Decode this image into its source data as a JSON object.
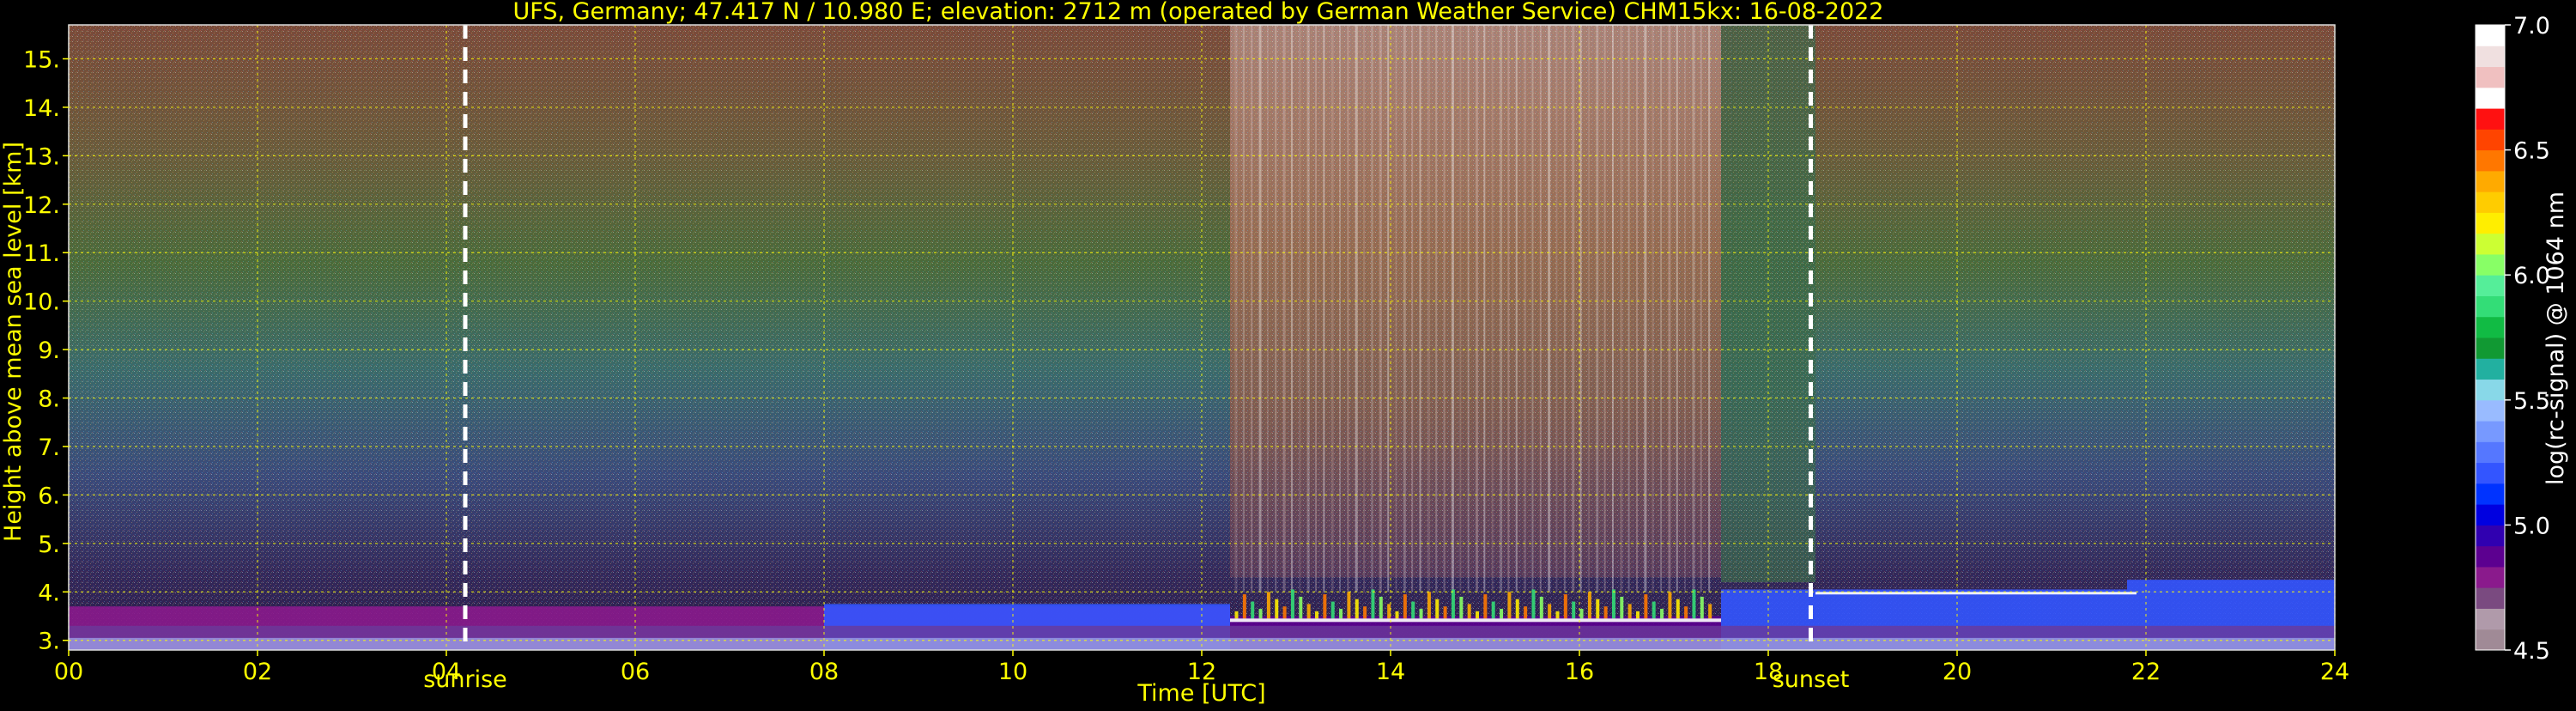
{
  "chart_data": {
    "type": "heatmap",
    "title": "UFS, Germany; 47.417 N / 10.980 E; elevation: 2712 m  (operated by German Weather Service)    CHM15kx: 16-08-2022",
    "xlabel": "Time [UTC]",
    "ylabel": "Height above mean sea level [km]",
    "xlim": [
      0,
      24
    ],
    "ylim": [
      2.8,
      15.7
    ],
    "x_ticks": [
      0,
      2,
      4,
      6,
      8,
      10,
      12,
      14,
      16,
      18,
      20,
      22,
      24
    ],
    "x_tick_labels": [
      "00",
      "02",
      "04",
      "06",
      "08",
      "10",
      "12",
      "14",
      "16",
      "18",
      "20",
      "22",
      "24"
    ],
    "y_ticks": [
      3,
      4,
      5,
      6,
      7,
      8,
      9,
      10,
      11,
      12,
      13,
      14,
      15
    ],
    "y_tick_labels": [
      "3.",
      "4.",
      "5.",
      "6.",
      "7.",
      "8.",
      "9.",
      "10.",
      "11.",
      "12.",
      "13.",
      "14.",
      "15."
    ],
    "grid": true,
    "annotations": [
      {
        "label": "sunrise",
        "x": 4.2
      },
      {
        "label": "sunset",
        "x": 18.45
      }
    ],
    "colorbar": {
      "label": "log(rc-signal) @ 1064 nm",
      "range": [
        4.5,
        7.0
      ],
      "ticks": [
        4.5,
        5.0,
        5.5,
        6.0,
        6.5,
        7.0
      ],
      "tick_labels": [
        "4.5",
        "5.0",
        "5.5",
        "6.0",
        "6.5",
        "7.0"
      ],
      "colors": [
        "#a08a96",
        "#b09aaa",
        "#7a4a80",
        "#8a1a8c",
        "#5c0090",
        "#3000b0",
        "#0000e0",
        "#0033ff",
        "#3355ff",
        "#5577ff",
        "#7799ff",
        "#99bbff",
        "#88d8e8",
        "#22b0a0",
        "#119933",
        "#11bb44",
        "#33dd77",
        "#55ee99",
        "#88ff66",
        "#ccff33",
        "#ffee00",
        "#ffcc00",
        "#ffaa00",
        "#ff7700",
        "#ff4400",
        "#ff1111",
        "#ffffff",
        "#f0c0c0",
        "#f0e0e0",
        "#ffffff"
      ]
    }
  }
}
